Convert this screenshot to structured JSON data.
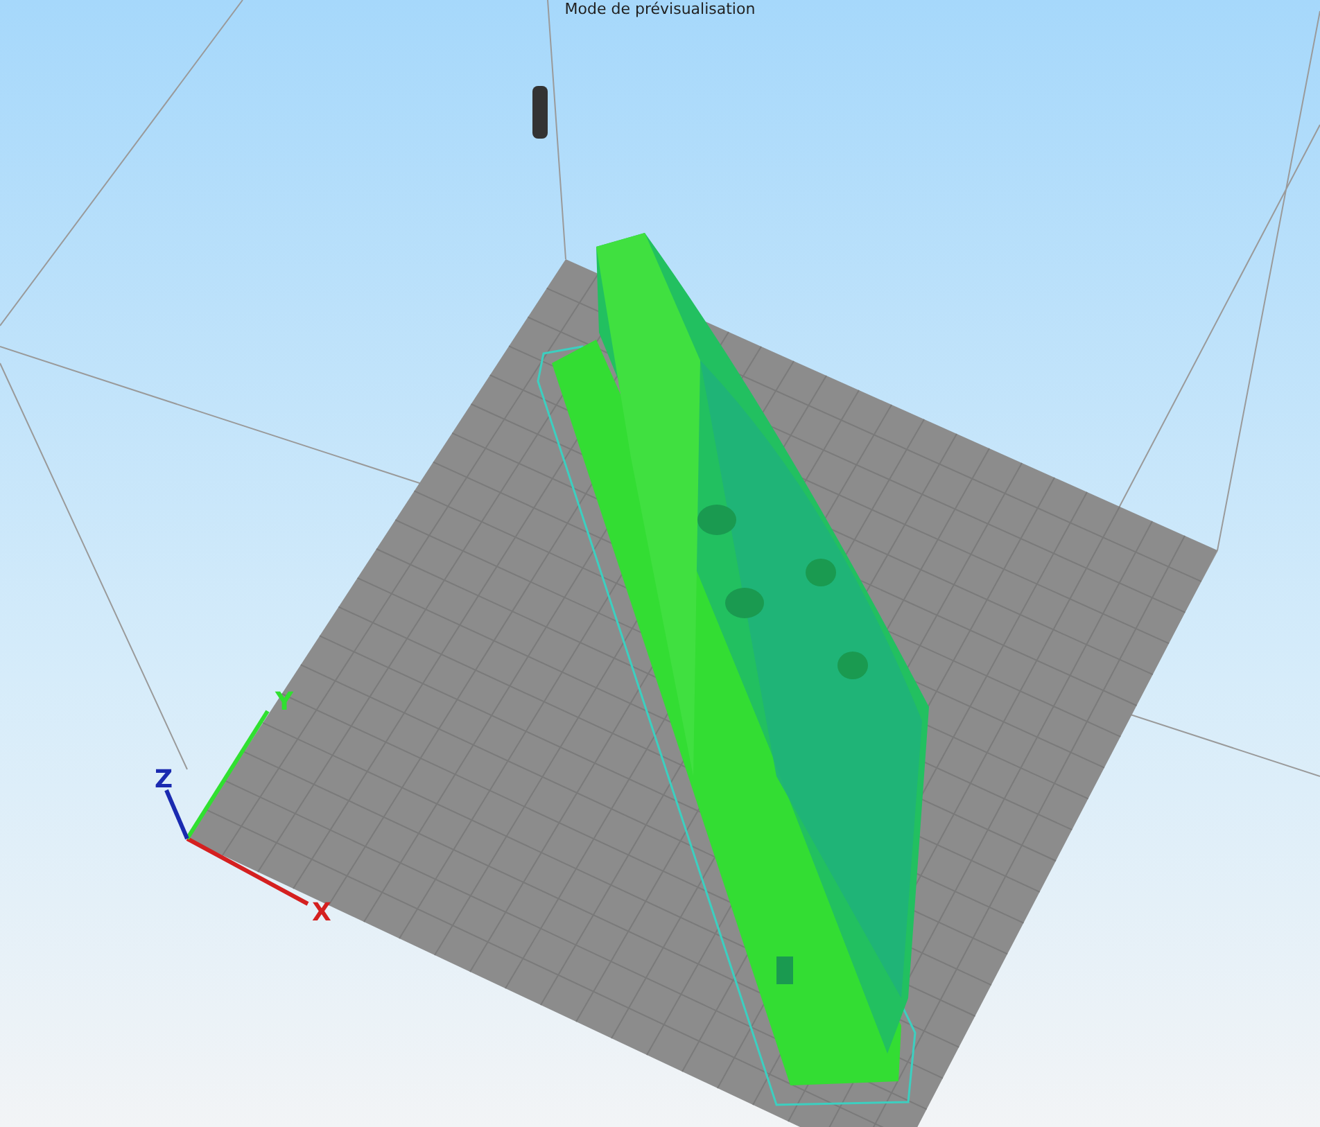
{
  "viewport": {
    "title": "Mode de prévisualisation"
  },
  "axes": [
    {
      "label": "X",
      "color": "#d42020"
    },
    {
      "label": "Y",
      "color": "#30e030"
    },
    {
      "label": "Z",
      "color": "#1a2ab0"
    }
  ]
}
